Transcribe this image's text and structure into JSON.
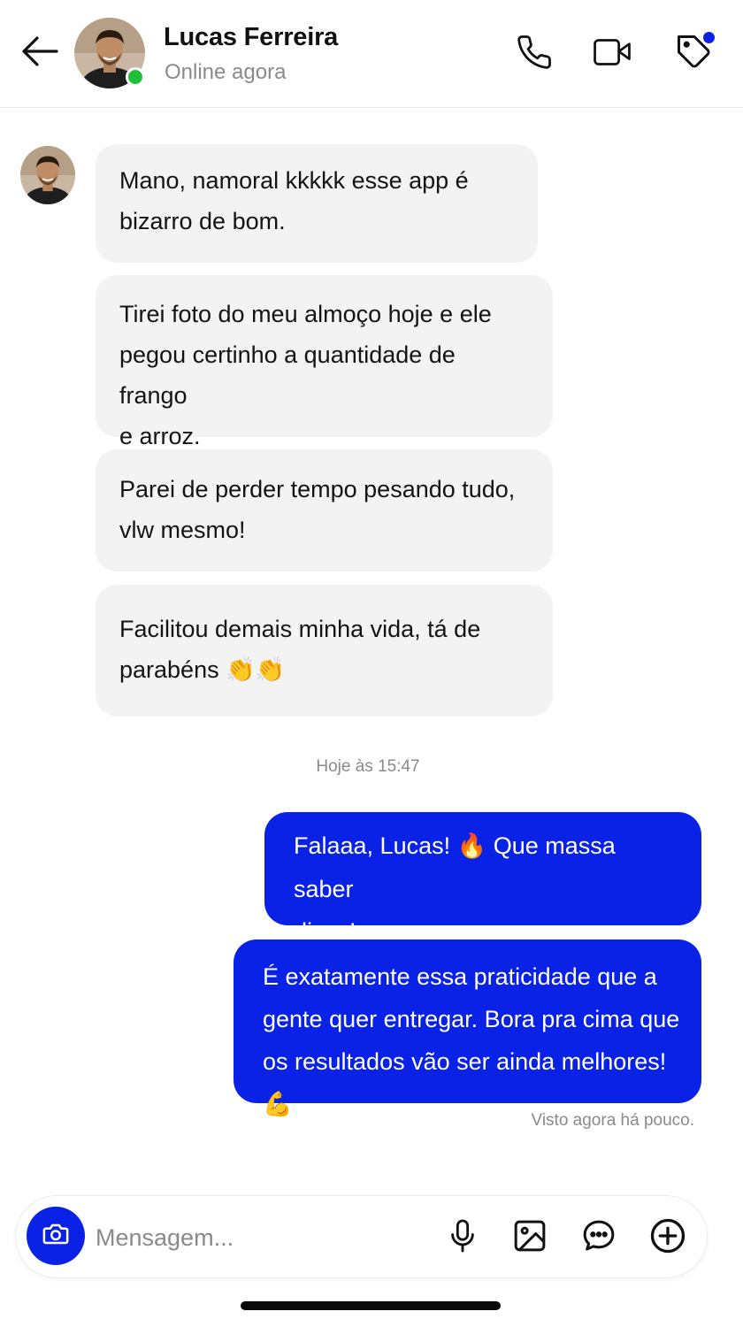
{
  "header": {
    "back_icon": "arrow-left-icon",
    "contact_name": "Lucas Ferreira",
    "status": "Online agora",
    "actions": [
      "phone-icon",
      "video-icon",
      "tag-icon"
    ],
    "notification_dot_color": "#0a22e6",
    "online_color": "#1fbf3a"
  },
  "messages_in": [
    {
      "line1": "Mano, namoral kkkkk esse app é",
      "line2": "bizarro de bom."
    },
    {
      "line1": "Tirei foto do meu almoço hoje e ele",
      "line2": "pegou certinho a quantidade de frango",
      "line3": "e arroz."
    },
    {
      "line1": "Parei de perder tempo pesando tudo,",
      "line2": "vlw mesmo!"
    },
    {
      "line1": "Facilitou demais minha vida, tá de",
      "line2": "parabéns",
      "emoji": "👏👏"
    }
  ],
  "timestamp": "Hoje às 15:47",
  "messages_out": [
    {
      "line1_a": "Falaaa, Lucas!",
      "emoji": "🔥",
      "line1_b": "Que massa saber",
      "line2": "disso!"
    },
    {
      "line1": "É exatamente essa praticidade que a",
      "line2": "gente quer entregar. Bora pra cima que",
      "line3": "os resultados vão ser ainda melhores!",
      "emoji": "💪"
    }
  ],
  "seen_status": "Visto agora há pouco.",
  "composer": {
    "placeholder": "Mensagem...",
    "icons": [
      "camera-icon",
      "microphone-icon",
      "image-icon",
      "chat-bubble-icon",
      "plus-circle-icon"
    ]
  },
  "colors": {
    "accent": "#0a22e6",
    "incoming_bubble": "#f3f3f3",
    "meta_text": "#8a8a8a"
  }
}
